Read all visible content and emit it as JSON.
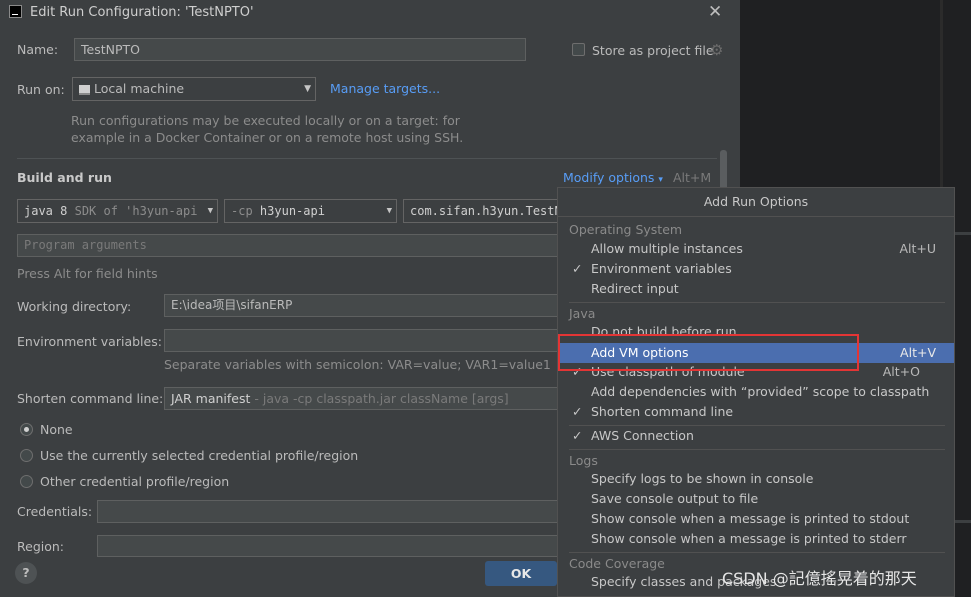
{
  "dialog": {
    "title": "Edit Run Configuration: 'TestNPTO'",
    "name_label": "Name:",
    "name_value": "TestNPTO",
    "store_label": "Store as project file",
    "run_on_label": "Run on:",
    "run_on_value": "Local machine",
    "manage_targets": "Manage targets...",
    "run_on_hint_1": "Run configurations may be executed locally or on a target: for",
    "run_on_hint_2": "example in a Docker Container or on a remote host using SSH.",
    "build_and_run": "Build and run",
    "modify_options": "Modify options",
    "modify_shortcut": "Alt+M",
    "jdk_strong": "java 8",
    "jdk_rest": "SDK of 'h3yun-api",
    "cp_prefix": "-cp",
    "cp_value": "h3yun-api",
    "main_class": "com.sifan.h3yun.TestN",
    "program_args_placeholder": "Program arguments",
    "alt_hint": "Press Alt for field hints",
    "working_dir_label": "Working directory:",
    "working_dir_value": "E:\\idea项目\\sifanERP",
    "env_label": "Environment variables:",
    "env_hint": "Separate variables with semicolon: VAR=value; VAR1=value1",
    "shorten_label": "Shorten command line:",
    "shorten_value": "JAR manifest",
    "shorten_hint": " - java -cp classpath.jar className [args]",
    "radio_none": "None",
    "radio_current": "Use the currently selected credential profile/region",
    "radio_other": "Other credential profile/region",
    "credentials_label": "Credentials:",
    "region_label": "Region:",
    "ok": "OK",
    "help": "?"
  },
  "popup": {
    "title": "Add Run Options",
    "sections": {
      "os": "Operating System",
      "java": "Java",
      "logs": "Logs",
      "coverage": "Code Coverage"
    },
    "items": {
      "allow_multiple": {
        "label": "Allow multiple instances",
        "shortcut": "Alt+U"
      },
      "env_vars": {
        "label": "Environment variables"
      },
      "redirect": {
        "label": "Redirect input"
      },
      "no_build": {
        "label": "Do not build before run"
      },
      "add_vm": {
        "label": "Add VM options",
        "shortcut": "Alt+V"
      },
      "classpath_module": {
        "label": "Use classpath of module",
        "shortcut": "Alt+O"
      },
      "add_deps": {
        "label": "Add dependencies with “provided” scope to classpath"
      },
      "shorten_cmd": {
        "label": "Shorten command line"
      },
      "aws": {
        "label": "AWS Connection"
      },
      "logs_console": {
        "label": "Specify logs to be shown in console"
      },
      "save_console": {
        "label": "Save console output to file"
      },
      "stdout": {
        "label": "Show console when a message is printed to stdout"
      },
      "stderr": {
        "label": "Show console when a message is printed to stderr"
      },
      "classes_packages": {
        "label": "Specify classes and packages"
      }
    },
    "check": "✓"
  },
  "watermark": "CSDN @記億搖晃着的那天",
  "colors": {
    "dialog_bg": "#3c3f41",
    "selection": "#4b6eaf",
    "link": "#589df6",
    "highlight_box": "#e33535"
  }
}
